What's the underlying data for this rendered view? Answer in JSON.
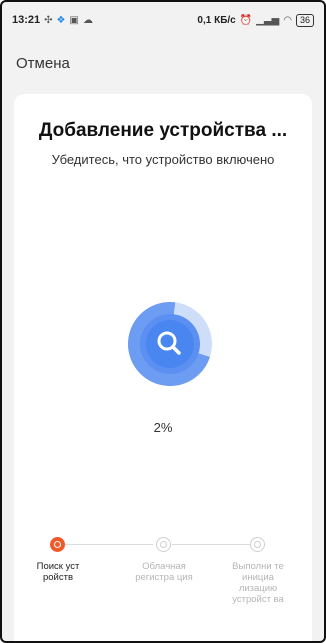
{
  "status_bar": {
    "time": "13:21",
    "icons_left": [
      "fan-icon",
      "app-icon",
      "image-icon",
      "cloud-icon"
    ],
    "network_speed": "0,1 КБ/с",
    "battery": "36",
    "icons_right": [
      "alarm-icon",
      "signal-icon",
      "wifi-icon"
    ]
  },
  "header": {
    "cancel_label": "Отмена"
  },
  "card": {
    "title": "Добавление устройства ...",
    "subtitle": "Убедитесь, что устройство включено",
    "progress_percent": "2%",
    "progress_value": 0.02
  },
  "steps": [
    {
      "label": "Поиск уст ройств",
      "state": "active"
    },
    {
      "label": "Облачная регистра ция",
      "state": "pending"
    },
    {
      "label": "Выполни те инициа лизацию устройст ва",
      "state": "pending"
    }
  ],
  "colors": {
    "accent_blue": "#4a86f0",
    "ring_light": "#cfdef8",
    "step_active": "#f05a28"
  }
}
